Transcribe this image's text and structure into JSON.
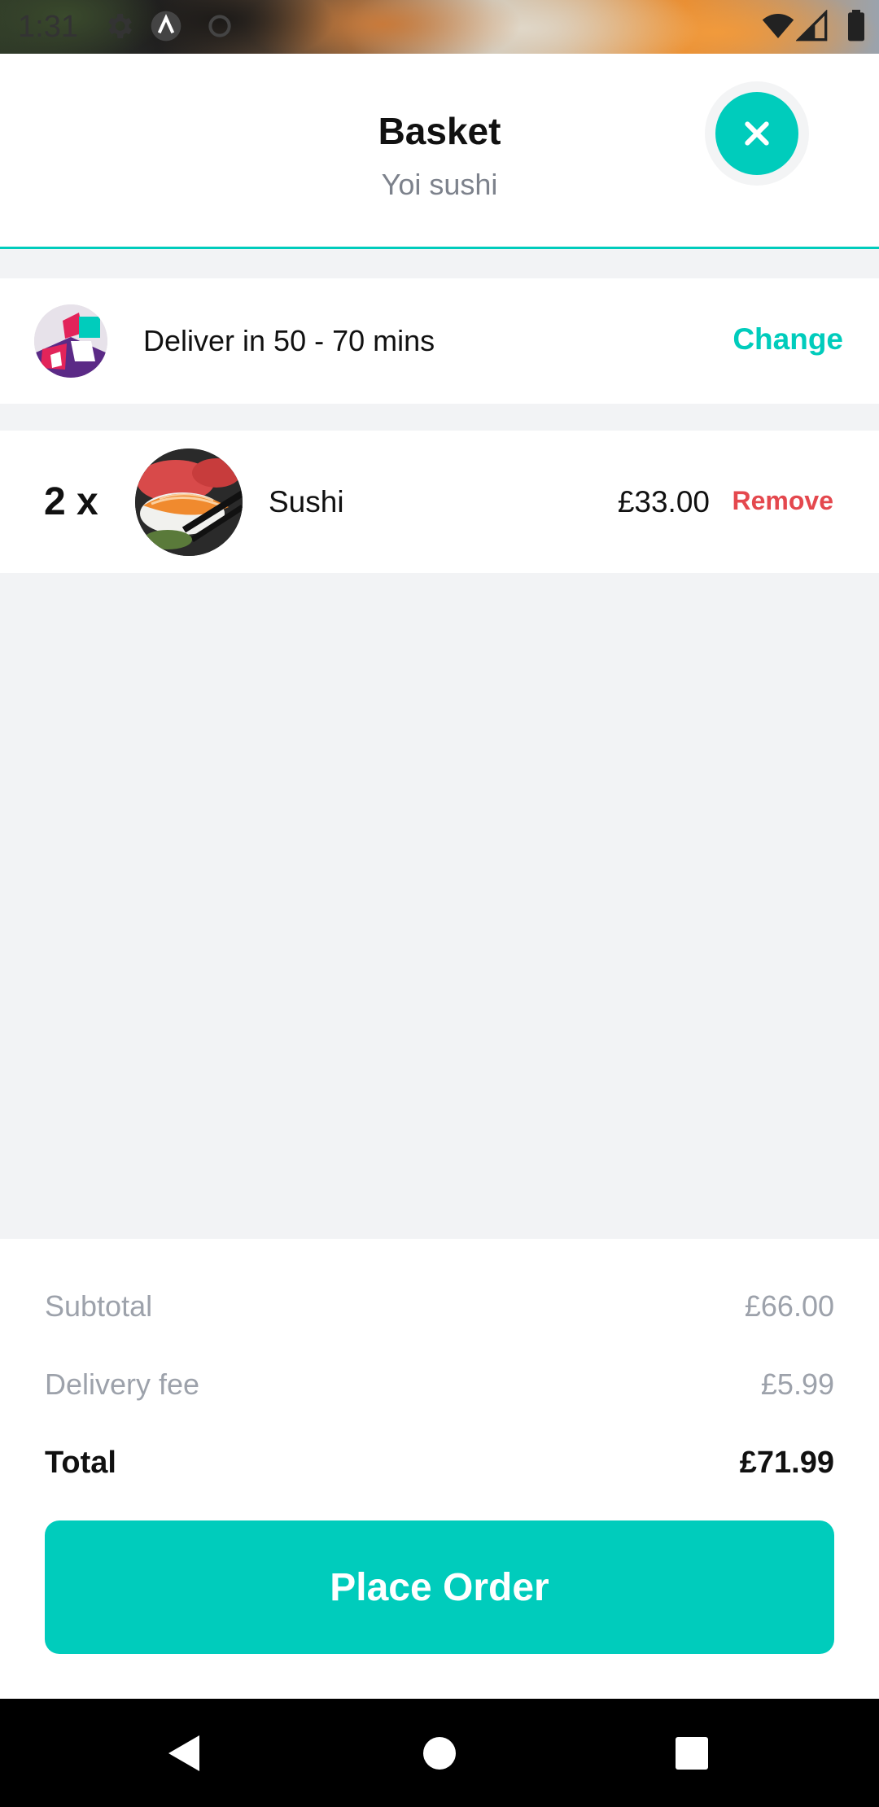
{
  "status_bar": {
    "time": "1:31",
    "icons": [
      "gear-icon",
      "a-icon",
      "sync-icon",
      "wifi-icon",
      "signal-icon",
      "battery-icon"
    ]
  },
  "header": {
    "title": "Basket",
    "subtitle": "Yoi sushi",
    "close_icon": "close-icon"
  },
  "delivery": {
    "text": "Deliver in 50 - 70 mins",
    "change_label": "Change"
  },
  "items": [
    {
      "qty": "2 x",
      "name": "Sushi",
      "price": "£33.00",
      "remove_label": "Remove"
    }
  ],
  "summary": {
    "subtotal_label": "Subtotal",
    "subtotal_value": "£66.00",
    "delivery_fee_label": "Delivery fee",
    "delivery_fee_value": "£5.99",
    "total_label": "Total",
    "total_value": "£71.99"
  },
  "place_order_label": "Place Order",
  "colors": {
    "accent": "#00ccbc",
    "remove": "#e4484e",
    "muted": "#9da2ab"
  }
}
